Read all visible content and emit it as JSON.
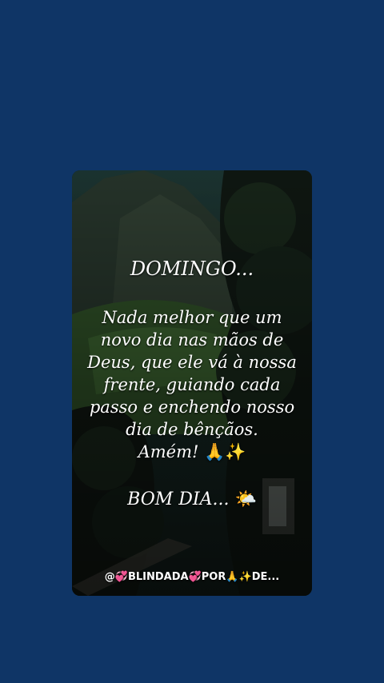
{
  "card": {
    "title": "DOMINGO...",
    "message_lines": [
      "Nada melhor que um",
      "novo dia nas mãos de",
      "Deus, que ele vá à nossa",
      "frente, guiando cada",
      "passo e enchendo nosso",
      "dia de bênçãos."
    ],
    "amen": "Amém!",
    "amen_emoji": "🙏✨",
    "closing": "BOM DIA...",
    "closing_emoji": "🌤️"
  },
  "footer": {
    "handle": "@💞BLINDADA💞POR🙏✨DE..."
  }
}
